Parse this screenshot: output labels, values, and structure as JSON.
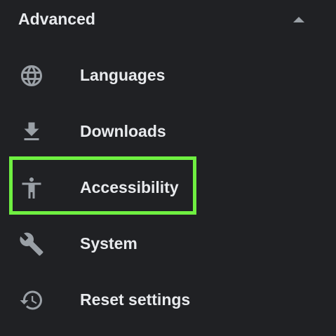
{
  "section": {
    "title": "Advanced",
    "expanded": true,
    "collapse_icon": "arrow-drop-up-icon"
  },
  "items": [
    {
      "label": "Languages",
      "icon": "globe-icon"
    },
    {
      "label": "Downloads",
      "icon": "download-icon"
    },
    {
      "label": "Accessibility",
      "icon": "accessibility-icon",
      "highlighted": true
    },
    {
      "label": "System",
      "icon": "wrench-icon"
    },
    {
      "label": "Reset settings",
      "icon": "restore-history-icon"
    }
  ],
  "colors": {
    "background": "#202124",
    "text": "#e8eaed",
    "icon": "#9aa0a6",
    "highlight": "#6ff041"
  }
}
